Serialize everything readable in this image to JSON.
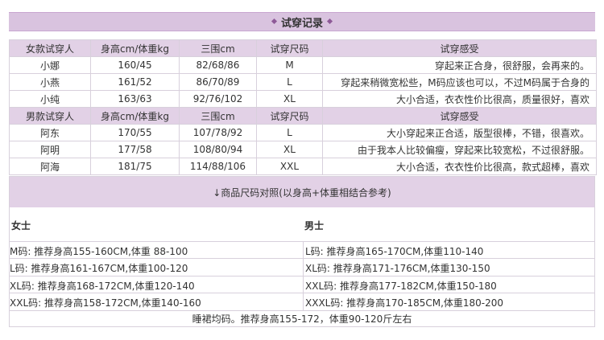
{
  "header": {
    "title": "试穿记录"
  },
  "fit_table": {
    "female_headers": [
      "女款试穿人",
      "身高cm/体重kg",
      "三围cm",
      "试穿尺码",
      "试穿感受"
    ],
    "female_rows": [
      [
        "小娜",
        "160/45",
        "82/68/86",
        "M",
        "穿起来正合身，很舒服，会再来的。"
      ],
      [
        "小燕",
        "161/52",
        "86/70/89",
        "L",
        "穿起来稍微宽松些，M码应该也可以，不过M码属于合身的"
      ],
      [
        "小纯",
        "163/63",
        "92/76/102",
        "XL",
        "大小合适，衣衣性价比很高，质量很好，喜欢"
      ]
    ],
    "male_headers": [
      "男款试穿人",
      "身高cm/体重kg",
      "三围cm",
      "试穿尺码",
      "试穿感受"
    ],
    "male_rows": [
      [
        "阿东",
        "170/55",
        "107/78/92",
        "L",
        "大小穿起来正合适，版型很棒，不错，很喜欢。"
      ],
      [
        "阿明",
        "177/58",
        "108/80/94",
        "XL",
        "由于我本人比较偏瘦，穿起来比较宽松，不过很舒服。"
      ],
      [
        "阿海",
        "181/75",
        "114/88/106",
        "XXL",
        "大小合适，衣衣性价比很高，款式超棒，喜欢"
      ]
    ]
  },
  "size_ref": {
    "title": "↓商品尺码对照(以身高+体重相结合参考)",
    "female_label": "女士",
    "male_label": "男士",
    "female_items": [
      "M码: 推荐身高155-160CM,体重 88-100",
      "L码: 推荐身高161-167CM,体重100-120",
      "XL码: 推荐身高168-172CM,体重120-140",
      "XXL码: 推荐身高158-172CM,体重140-160"
    ],
    "male_items": [
      "L码: 推荐身高165-170CM,体重110-140",
      "XL码: 推荐身高171-176CM,体重130-150",
      "XXL码: 推荐身高177-182CM,体重150-180",
      "XXXL码: 推荐身高170-185CM,体重180-200"
    ],
    "footer": "睡裙均码。推荐身高155-172，体重90-120斤左右"
  }
}
